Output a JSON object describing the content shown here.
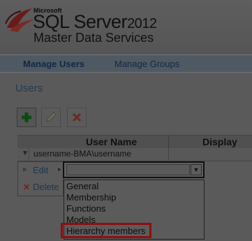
{
  "brand": {
    "company": "Microsoft",
    "product": "SQL Server",
    "version": "2012",
    "subtitle": "Master Data Services",
    "logo_icon": "sql-server-logo-icon"
  },
  "nav": {
    "items": [
      {
        "label": "Manage Users",
        "active": true
      },
      {
        "label": "Manage Groups",
        "active": false
      }
    ]
  },
  "page": {
    "title": "Users"
  },
  "toolbar": {
    "add_icon": "add-icon",
    "edit_icon": "pencil-icon",
    "delete_icon": "delete-x-icon"
  },
  "grid": {
    "columns": [
      "User Name",
      "Display"
    ],
    "rows": [
      {
        "user_name": "username-BMA\\username",
        "display": ""
      }
    ]
  },
  "context_menu": {
    "items": [
      {
        "label": "Edit",
        "glyph": "»",
        "submenu_arrow": "▸"
      },
      {
        "label": "Delete",
        "glyph": "✕"
      }
    ]
  },
  "dropdown": {
    "value": "",
    "options": [
      "General",
      "Membership",
      "Functions",
      "Models",
      "Hierarchy members"
    ],
    "highlighted": "Hierarchy members"
  },
  "colors": {
    "highlight": "#8f0e0e",
    "link": "#0e2a46"
  }
}
